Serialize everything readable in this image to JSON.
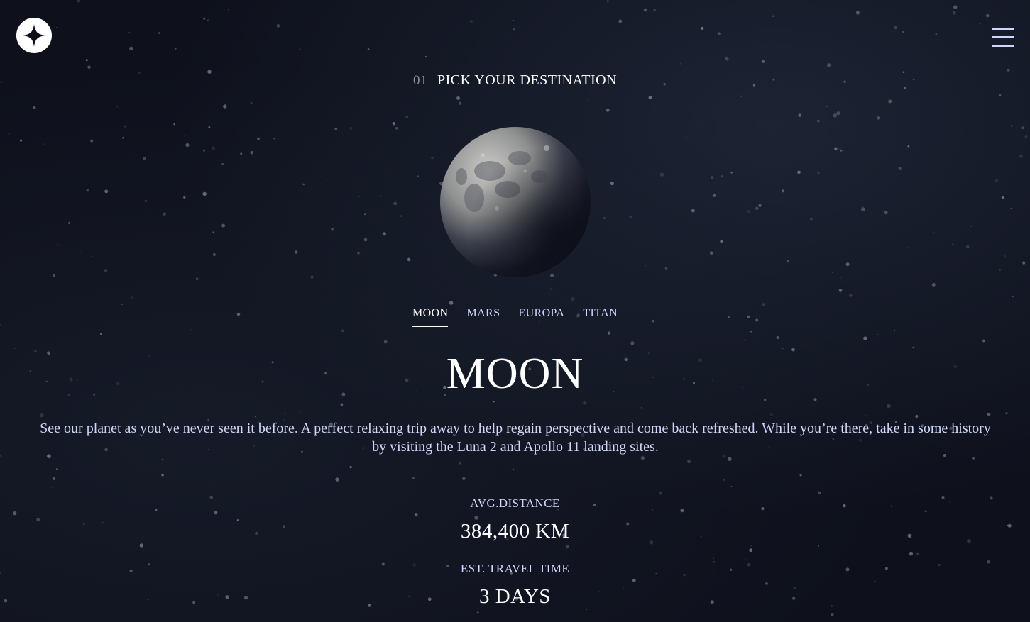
{
  "header": {
    "logo_icon": "four-point-star-icon",
    "menu_icon": "hamburger-menu-icon"
  },
  "subheading": {
    "number": "01",
    "text": "PICK YOUR DESTINATION"
  },
  "tabs": [
    {
      "label": "MOON",
      "active": true
    },
    {
      "label": "MARS",
      "active": false
    },
    {
      "label": "EUROPA",
      "active": false
    },
    {
      "label": "TITAN",
      "active": false
    }
  ],
  "destination": {
    "name": "MOON",
    "description": "See our planet as you’ve never seen it before. A perfect relaxing trip away to help regain perspective and come back refreshed. While you’re there, take in some history by visiting the Luna 2 and Apollo 11 landing sites.",
    "stats": {
      "distance_label": "AVG.DISTANCE",
      "distance_value": "384,400 KM",
      "travel_label": "EST. TRAVEL TIME",
      "travel_value": "3 DAYS"
    }
  },
  "colors": {
    "background": "#0b0d17",
    "accent_light": "#d0d6f9",
    "white": "#ffffff"
  }
}
